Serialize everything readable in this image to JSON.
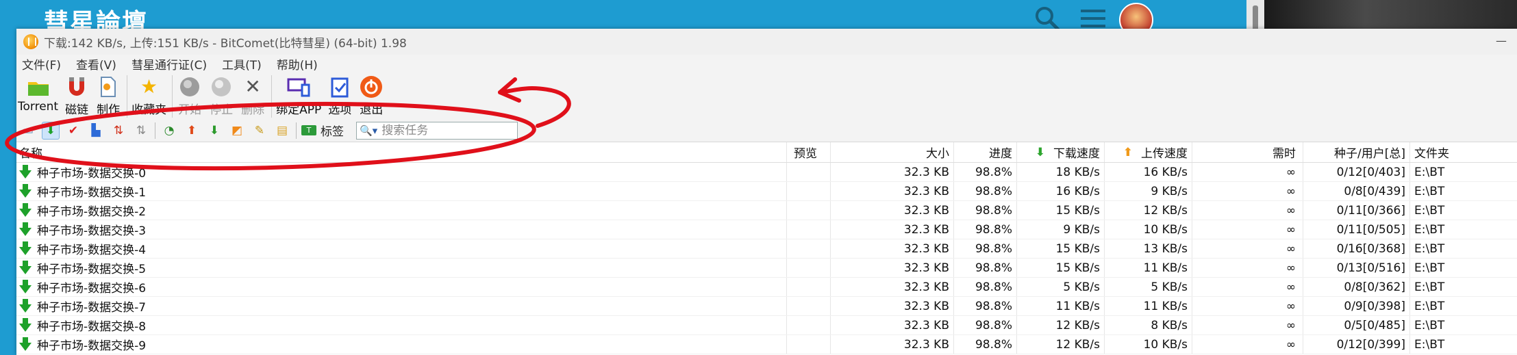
{
  "site": {
    "logo_text": "彗星論壇"
  },
  "window": {
    "title": "下载:142 KB/s, 上传:151 KB/s - BitComet(比特彗星) (64-bit) 1.98"
  },
  "menu": [
    "文件(F)",
    "查看(V)",
    "彗星通行证(C)",
    "工具(T)",
    "帮助(H)"
  ],
  "toolbar": {
    "torrent": "Torrent",
    "magnet": "磁链",
    "make": "制作",
    "favorites": "收藏夹",
    "start": "开始",
    "stop": "停止",
    "delete": "删除",
    "bind_app": "绑定APP",
    "options": "选项",
    "exit": "退出"
  },
  "filterbar": {
    "tag_label": "标签",
    "search_placeholder": "搜索任务"
  },
  "columns": {
    "name": "名称",
    "preview": "预览",
    "size": "大小",
    "progress": "进度",
    "download_speed": "下载速度",
    "upload_speed": "上传速度",
    "eta": "需时",
    "seeds_peers": "种子/用户[总]",
    "folder": "文件夹"
  },
  "rows": [
    {
      "name": "种子市场-数据交换-0",
      "size": "32.3 KB",
      "progress": "98.8%",
      "dl": "18 KB/s",
      "ul": "16 KB/s",
      "eta": "∞",
      "peers": "0/12[0/403]",
      "folder": "E:\\BT"
    },
    {
      "name": "种子市场-数据交换-1",
      "size": "32.3 KB",
      "progress": "98.8%",
      "dl": "16 KB/s",
      "ul": "9 KB/s",
      "eta": "∞",
      "peers": "0/8[0/439]",
      "folder": "E:\\BT"
    },
    {
      "name": "种子市场-数据交换-2",
      "size": "32.3 KB",
      "progress": "98.8%",
      "dl": "15 KB/s",
      "ul": "12 KB/s",
      "eta": "∞",
      "peers": "0/11[0/366]",
      "folder": "E:\\BT"
    },
    {
      "name": "种子市场-数据交换-3",
      "size": "32.3 KB",
      "progress": "98.8%",
      "dl": "9 KB/s",
      "ul": "10 KB/s",
      "eta": "∞",
      "peers": "0/11[0/505]",
      "folder": "E:\\BT"
    },
    {
      "name": "种子市场-数据交换-4",
      "size": "32.3 KB",
      "progress": "98.8%",
      "dl": "15 KB/s",
      "ul": "13 KB/s",
      "eta": "∞",
      "peers": "0/16[0/368]",
      "folder": "E:\\BT"
    },
    {
      "name": "种子市场-数据交换-5",
      "size": "32.3 KB",
      "progress": "98.8%",
      "dl": "15 KB/s",
      "ul": "11 KB/s",
      "eta": "∞",
      "peers": "0/13[0/516]",
      "folder": "E:\\BT"
    },
    {
      "name": "种子市场-数据交换-6",
      "size": "32.3 KB",
      "progress": "98.8%",
      "dl": "5 KB/s",
      "ul": "5 KB/s",
      "eta": "∞",
      "peers": "0/8[0/362]",
      "folder": "E:\\BT"
    },
    {
      "name": "种子市场-数据交换-7",
      "size": "32.3 KB",
      "progress": "98.8%",
      "dl": "11 KB/s",
      "ul": "11 KB/s",
      "eta": "∞",
      "peers": "0/9[0/398]",
      "folder": "E:\\BT"
    },
    {
      "name": "种子市场-数据交换-8",
      "size": "32.3 KB",
      "progress": "98.8%",
      "dl": "12 KB/s",
      "ul": "8 KB/s",
      "eta": "∞",
      "peers": "0/5[0/485]",
      "folder": "E:\\BT"
    },
    {
      "name": "种子市场-数据交换-9",
      "size": "32.3 KB",
      "progress": "98.8%",
      "dl": "12 KB/s",
      "ul": "10 KB/s",
      "eta": "∞",
      "peers": "0/12[0/399]",
      "folder": "E:\\BT"
    }
  ],
  "colors": {
    "site_bg": "#1e9cd1",
    "annotation": "#e0101a",
    "download_green": "#1ea12a",
    "upload_orange": "#f09a1a"
  }
}
